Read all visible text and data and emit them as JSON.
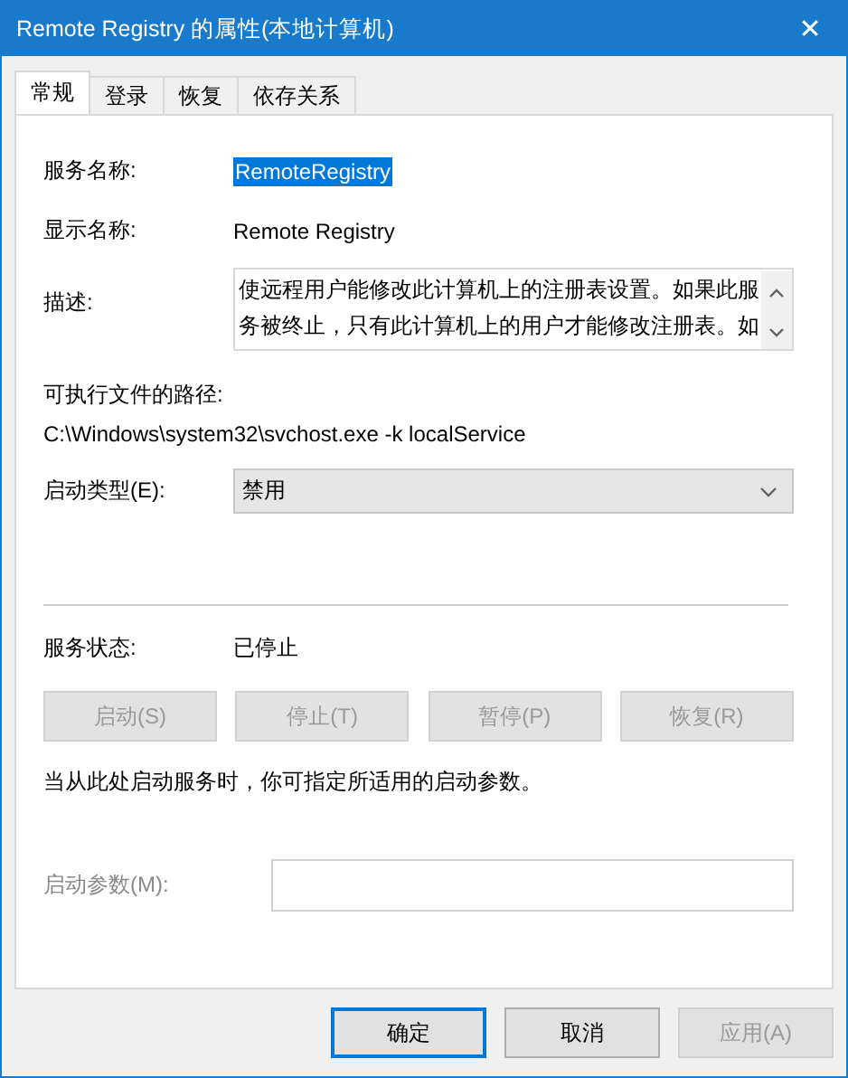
{
  "window": {
    "title": "Remote Registry 的属性(本地计算机)",
    "close": "✕"
  },
  "tabs": [
    {
      "label": "常规",
      "selected": true
    },
    {
      "label": "登录",
      "selected": false
    },
    {
      "label": "恢复",
      "selected": false
    },
    {
      "label": "依存关系",
      "selected": false
    }
  ],
  "service_name": {
    "label": "服务名称:",
    "value": "RemoteRegistry",
    "highlighted": true
  },
  "display_name": {
    "label": "显示名称:",
    "value": "Remote Registry"
  },
  "description": {
    "label": "描述:",
    "value": "使远程用户能修改此计算机上的注册表设置。如果此服务被终止，只有此计算机上的用户才能修改注册表。如"
  },
  "executable": {
    "label": "可执行文件的路径:",
    "value": "C:\\Windows\\system32\\svchost.exe -k localService"
  },
  "startup_type": {
    "label": "启动类型(E):",
    "value": "禁用"
  },
  "service_status": {
    "label": "服务状态:",
    "value": "已停止"
  },
  "control_buttons": [
    {
      "label": "启动(S)",
      "disabled": true
    },
    {
      "label": "停止(T)",
      "disabled": true
    },
    {
      "label": "暂停(P)",
      "disabled": true
    },
    {
      "label": "恢复(R)",
      "disabled": true
    }
  ],
  "hint": "当从此处启动服务时，你可指定所适用的启动参数。",
  "start_parameters": {
    "label": "启动参数(M):",
    "disabled": true
  },
  "dialog_buttons": [
    {
      "label": "确定",
      "disabled": false,
      "default": true
    },
    {
      "label": "取消",
      "disabled": false,
      "default": false
    },
    {
      "label": "应用(A)",
      "disabled": true,
      "default": false
    }
  ]
}
